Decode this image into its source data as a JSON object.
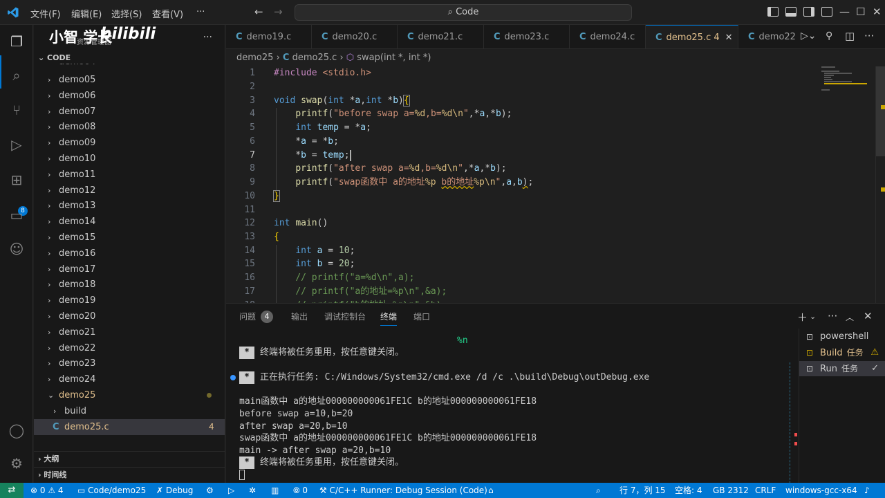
{
  "titlebar": {
    "menus": [
      "文件(F)",
      "编辑(E)",
      "选择(S)",
      "查看(V)",
      "···"
    ],
    "command_center": "Code"
  },
  "watermark": {
    "text": "小智 学长",
    "bili": "bilibili",
    "sub": "资源管理器"
  },
  "sidebar": {
    "section_code": "CODE",
    "items": [
      {
        "label": "demo05",
        "type": "folder"
      },
      {
        "label": "demo06",
        "type": "folder"
      },
      {
        "label": "demo07",
        "type": "folder"
      },
      {
        "label": "demo08",
        "type": "folder"
      },
      {
        "label": "demo09",
        "type": "folder"
      },
      {
        "label": "demo10",
        "type": "folder"
      },
      {
        "label": "demo11",
        "type": "folder"
      },
      {
        "label": "demo12",
        "type": "folder"
      },
      {
        "label": "demo13",
        "type": "folder"
      },
      {
        "label": "demo14",
        "type": "folder"
      },
      {
        "label": "demo15",
        "type": "folder"
      },
      {
        "label": "demo16",
        "type": "folder"
      },
      {
        "label": "demo17",
        "type": "folder"
      },
      {
        "label": "demo18",
        "type": "folder"
      },
      {
        "label": "demo19",
        "type": "folder"
      },
      {
        "label": "demo20",
        "type": "folder"
      },
      {
        "label": "demo21",
        "type": "folder"
      },
      {
        "label": "demo22",
        "type": "folder"
      },
      {
        "label": "demo23",
        "type": "folder"
      },
      {
        "label": "demo24",
        "type": "folder"
      }
    ],
    "open_folder": "demo25",
    "sub_folder": "build",
    "open_file": "demo25.c",
    "open_file_problems": "4",
    "section_outline": "大纲",
    "section_timeline": "时间线"
  },
  "tabs": [
    {
      "label": "demo19.c"
    },
    {
      "label": "demo20.c"
    },
    {
      "label": "demo21.c"
    },
    {
      "label": "demo23.c"
    },
    {
      "label": "demo24.c"
    },
    {
      "label": "demo25.c",
      "badge": "4"
    },
    {
      "label": "demo22"
    }
  ],
  "breadcrumb": {
    "folder": "demo25",
    "file": "demo25.c",
    "symbol": "swap(int *, int *)"
  },
  "editor": {
    "line_numbers": [
      "1",
      "2",
      "3",
      "4",
      "5",
      "6",
      "7",
      "8",
      "9",
      "10",
      "11",
      "12",
      "13",
      "14",
      "15",
      "16",
      "17",
      "18"
    ],
    "current_line": "7"
  },
  "panel": {
    "tabs": [
      "问题",
      "输出",
      "调试控制台",
      "终端",
      "端口"
    ],
    "problems_count": "4",
    "active_tab": "终端",
    "terminal_lines": {
      "pct_n": "%n",
      "reuse1": "终端将被任务重用，按任意键关闭。",
      "exec": "正在执行任务: C:/Windows/System32/cmd.exe /d /c .\\build\\Debug\\outDebug.exe",
      "main_addr": "main函数中 a的地址000000000061FE1C b的地址000000000061FE18",
      "before": "before swap a=10,b=20",
      "after": "after swap a=20,b=10",
      "swap_addr": "swap函数中 a的地址000000000061FE1C b的地址000000000061FE18",
      "main_after": "main -> after swap a=20,b=10",
      "reuse2": "终端将被任务重用，按任意键关闭。"
    },
    "terminals": [
      {
        "name": "powershell",
        "sub": ""
      },
      {
        "name": "Build",
        "sub": "任务"
      },
      {
        "name": "Run",
        "sub": "任务"
      }
    ]
  },
  "statusbar": {
    "errors": "0",
    "warnings": "4",
    "folder": "Code/demo25",
    "debug": "Debug",
    "ports": "0",
    "runner": "C/C++ Runner: Debug Session (Code)",
    "position": "行 7，列 15",
    "spaces": "空格: 4",
    "encoding": "GB 2312",
    "eol": "CRLF",
    "compiler": "windows-gcc-x64"
  },
  "colors": {
    "accent": "#0078d4",
    "statusbar": "#0078d4",
    "remote": "#16825d",
    "modified": "#e2c08d"
  }
}
